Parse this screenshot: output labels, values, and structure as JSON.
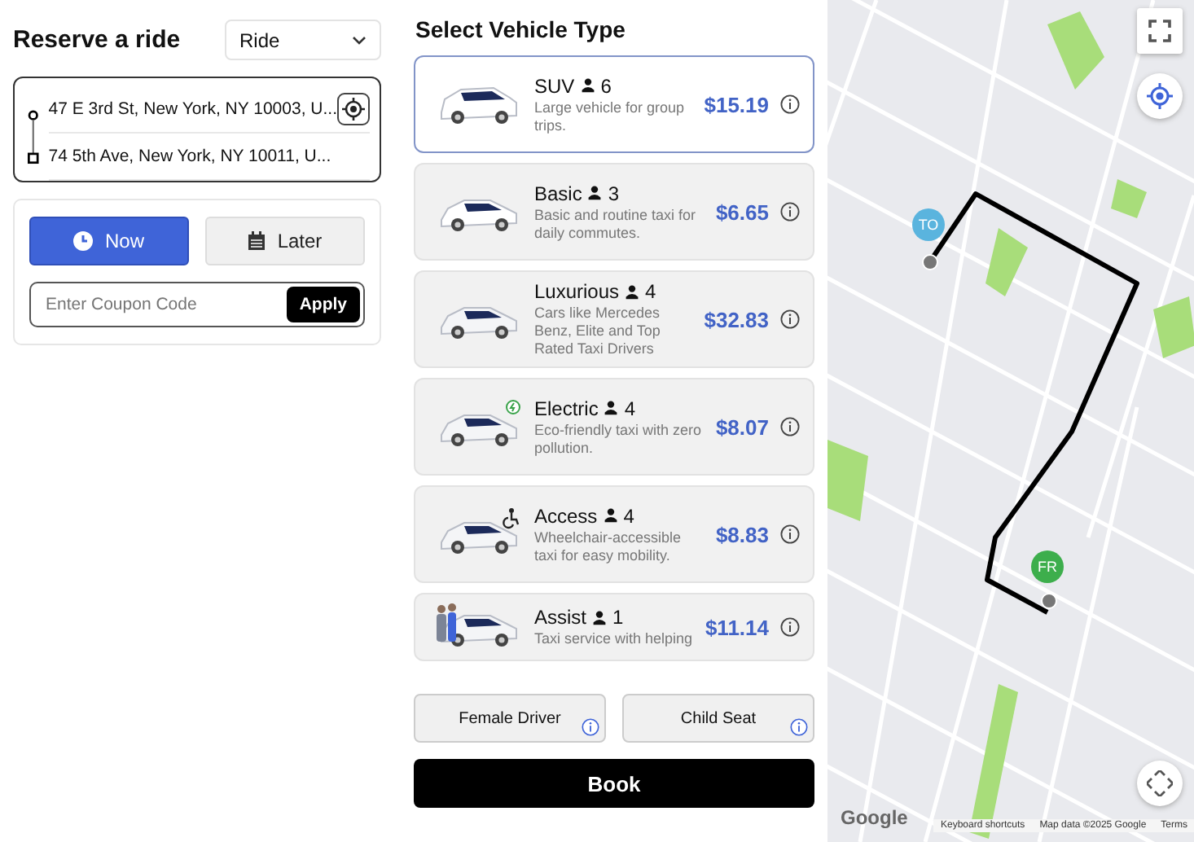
{
  "header": {
    "title": "Reserve a ride",
    "mode_select": {
      "value": "Ride"
    }
  },
  "route": {
    "pickup": "47 E 3rd St, New York, NY 10003, U...",
    "dropoff": "74 5th Ave, New York, NY 10011, U..."
  },
  "timing": [
    {
      "kind": "now",
      "label": "Now",
      "selected": true
    },
    {
      "kind": "later",
      "label": "Later",
      "selected": false
    }
  ],
  "coupon": {
    "placeholder": "Enter Coupon Code",
    "button": "Apply"
  },
  "vehicle_section": {
    "title": "Select Vehicle Type",
    "vehicles": [
      {
        "kind": "suv",
        "name": "SUV",
        "seats": "6",
        "description": "Large vehicle for group trips.",
        "price": "$15.19",
        "selected": true
      },
      {
        "kind": "basic",
        "name": "Basic",
        "seats": "3",
        "description": "Basic and routine taxi for daily commutes.",
        "price": "$6.65",
        "selected": false
      },
      {
        "kind": "luxury",
        "name": "Luxurious",
        "seats": "4",
        "description": "Cars like Mercedes Benz, Elite and Top Rated Taxi Drivers",
        "price": "$32.83",
        "selected": false
      },
      {
        "kind": "electric",
        "name": "Electric",
        "seats": "4",
        "description": "Eco-friendly taxi with zero pollution.",
        "price": "$8.07",
        "selected": false
      },
      {
        "kind": "access",
        "name": "Access",
        "seats": "4",
        "description": "Wheelchair-accessible taxi for easy mobility.",
        "price": "$8.83",
        "selected": false
      },
      {
        "kind": "assist",
        "name": "Assist",
        "seats": "1",
        "description": "Taxi service with helping",
        "price": "$11.14",
        "selected": false
      }
    ]
  },
  "options": [
    {
      "label": "Female Driver"
    },
    {
      "label": "Child Seat"
    }
  ],
  "book_button": "Book",
  "map": {
    "markers": [
      {
        "label": "TO",
        "color": "#5ab4de"
      },
      {
        "label": "FR",
        "color": "#3dae4c"
      }
    ],
    "logo": "Google",
    "attribution": [
      "Keyboard shortcuts",
      "Map data ©2025 Google",
      "Terms"
    ]
  }
}
